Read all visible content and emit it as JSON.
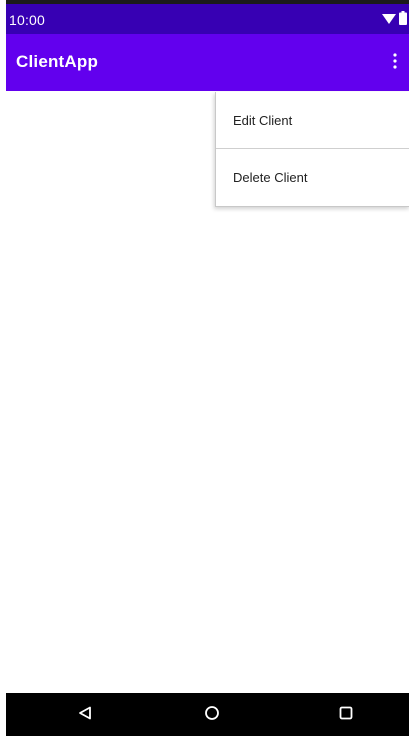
{
  "status_bar": {
    "time": "10:00",
    "icons": [
      "wifi-icon",
      "battery-icon"
    ],
    "background": "#3700b3"
  },
  "app_bar": {
    "title": "ClientApp",
    "background": "#6200ee",
    "overflow_icon": "more-vert-icon"
  },
  "menu": {
    "items": [
      {
        "label": "Edit Client"
      },
      {
        "label": "Delete Client"
      }
    ]
  },
  "nav_bar": {
    "buttons": [
      "back-icon",
      "home-icon",
      "recents-icon"
    ],
    "background": "#000000"
  }
}
